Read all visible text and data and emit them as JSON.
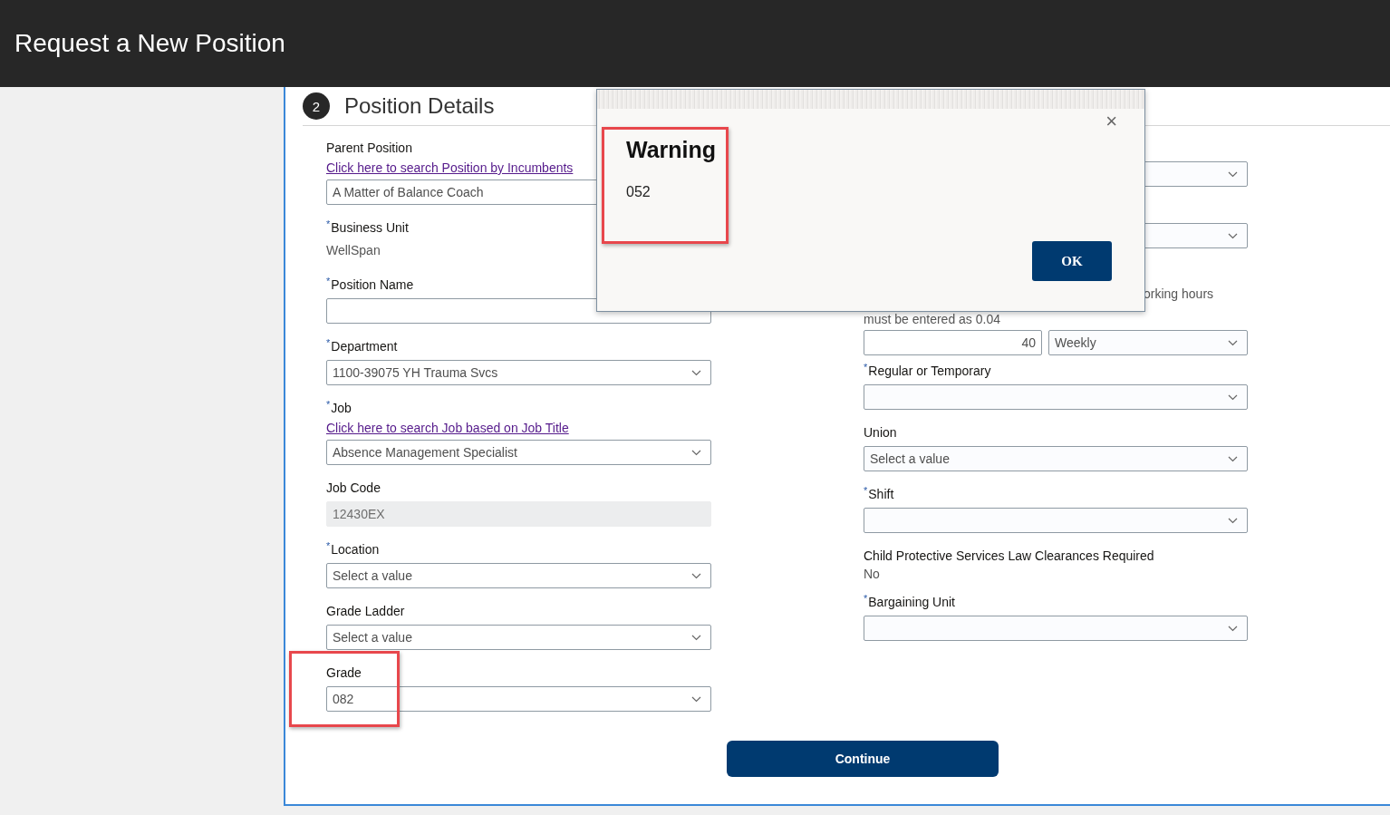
{
  "header": {
    "title": "Request a New Position"
  },
  "section": {
    "step": "2",
    "title": "Position Details"
  },
  "left_fields": [
    {
      "kind": "text",
      "label": "Parent Position",
      "link": "Click here to search Position by Incumbents",
      "value": "A Matter of Balance Coach",
      "disabled": false
    },
    {
      "kind": "static",
      "label": "Business Unit",
      "required_mark": "*",
      "value": "WellSpan"
    },
    {
      "kind": "text",
      "label": "Position Name",
      "required_mark": "*",
      "disabled": false
    },
    {
      "kind": "select",
      "label": "Department",
      "required_mark": "*",
      "value": "1100-39075 YH Trauma Svcs"
    },
    {
      "kind": "select",
      "label": "Job",
      "required_mark": "*",
      "link": "Click here to search Job based on Job Title",
      "value": "Absence Management Specialist"
    },
    {
      "kind": "text",
      "label": "Job Code",
      "value": "12430EX",
      "disabled": true
    },
    {
      "kind": "select",
      "label": "Location",
      "required_mark": "*",
      "placeholder": "Select a value"
    },
    {
      "kind": "select",
      "label": "Grade Ladder",
      "placeholder": "Select a value"
    },
    {
      "kind": "select",
      "label": "Grade",
      "value": "082",
      "highlighted": true
    }
  ],
  "right_fields": [
    {
      "kind": "select"
    },
    {
      "kind": "select"
    },
    {
      "kind": "hours",
      "help": [
        "orking hours",
        "must be entered as 0.04"
      ],
      "hours": "40",
      "frequency": "Weekly"
    },
    {
      "kind": "select",
      "label": "Regular or Temporary",
      "required_mark": "*"
    },
    {
      "kind": "select",
      "label": "Union",
      "placeholder": "Select a value"
    },
    {
      "kind": "select",
      "label": "Shift",
      "required_mark": "*"
    },
    {
      "kind": "static",
      "label": "Child Protective Services Law Clearances Required",
      "value": "No"
    },
    {
      "kind": "select",
      "label": "Bargaining Unit",
      "required_mark": "*"
    }
  ],
  "continue_button": "Continue",
  "dialog": {
    "title": "Warning",
    "message": "052",
    "button": "OK",
    "close": "×",
    "highlighted": true
  }
}
